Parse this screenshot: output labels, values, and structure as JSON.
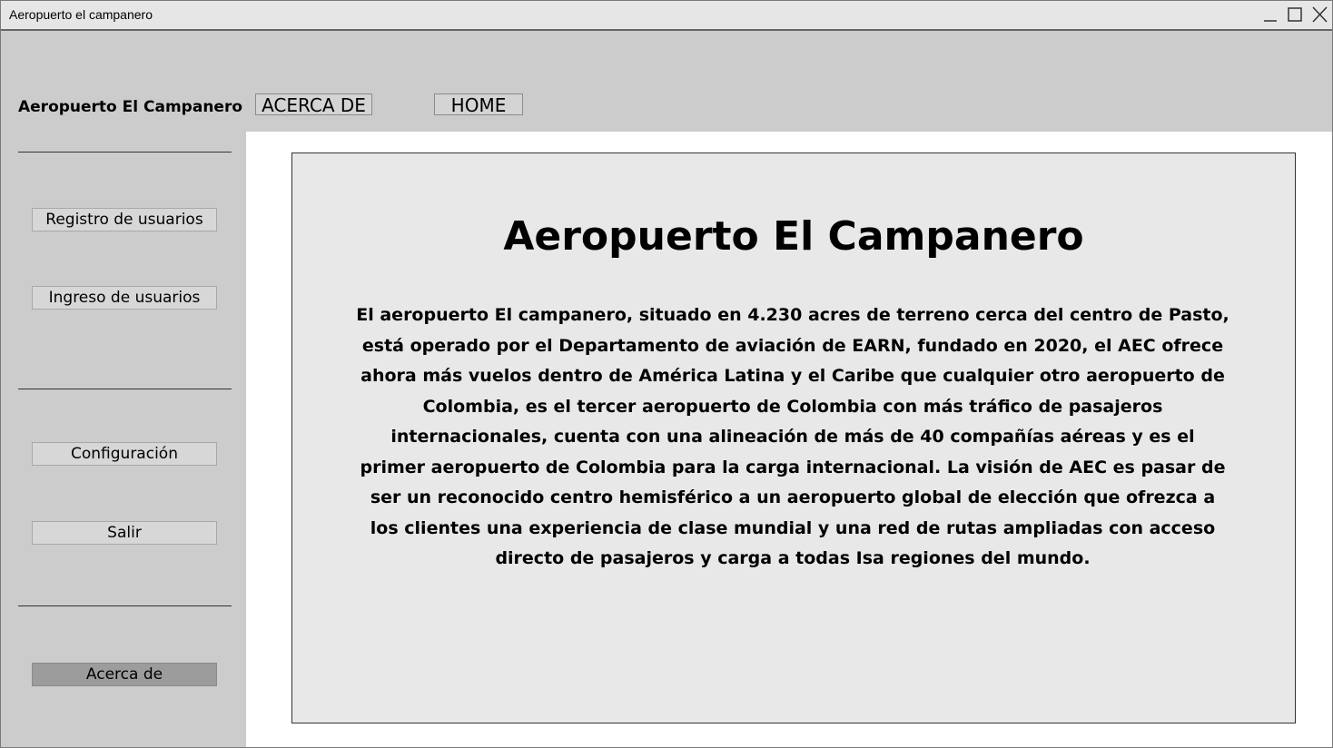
{
  "window": {
    "title": "Aeropuerto el campanero"
  },
  "header": {
    "brand": "Aeropuerto El Campanero",
    "nav": [
      {
        "label": "ACERCA DE"
      },
      {
        "label": "HOME"
      }
    ]
  },
  "sidebar": {
    "items": [
      {
        "label": "Registro de usuarios"
      },
      {
        "label": "Ingreso de usuarios"
      },
      {
        "label": "Configuración"
      },
      {
        "label": "Salir"
      },
      {
        "label": "Acerca de",
        "active": true
      }
    ]
  },
  "main": {
    "title": "Aeropuerto El Campanero",
    "body": "El aeropuerto El campanero, situado en 4.230 acres de terreno cerca del centro de Pasto, está operado por el Departamento de aviación de EARN, fundado en 2020, el AEC ofrece ahora más vuelos dentro de América Latina y el Caribe que cualquier otro aeropuerto de Colombia, es el tercer aeropuerto de Colombia con más tráfico de pasajeros internacionales, cuenta con una alineación de más de 40 compañías aéreas y es el primer aeropuerto de Colombia para la carga internacional. La visión de AEC es pasar de ser un reconocido centro hemisférico a un aeropuerto global de elección que ofrezca a los clientes una experiencia de clase mundial y una red de rutas ampliadas con acceso directo de pasajeros y carga a todas Isa regiones del mundo."
  },
  "icons": {
    "minimize": "minimize-icon",
    "maximize": "maximize-icon",
    "close": "close-icon"
  },
  "colors": {
    "chrome": "#cccccc",
    "content_bg": "#e8e8e8",
    "active_button": "#9c9c9c"
  }
}
